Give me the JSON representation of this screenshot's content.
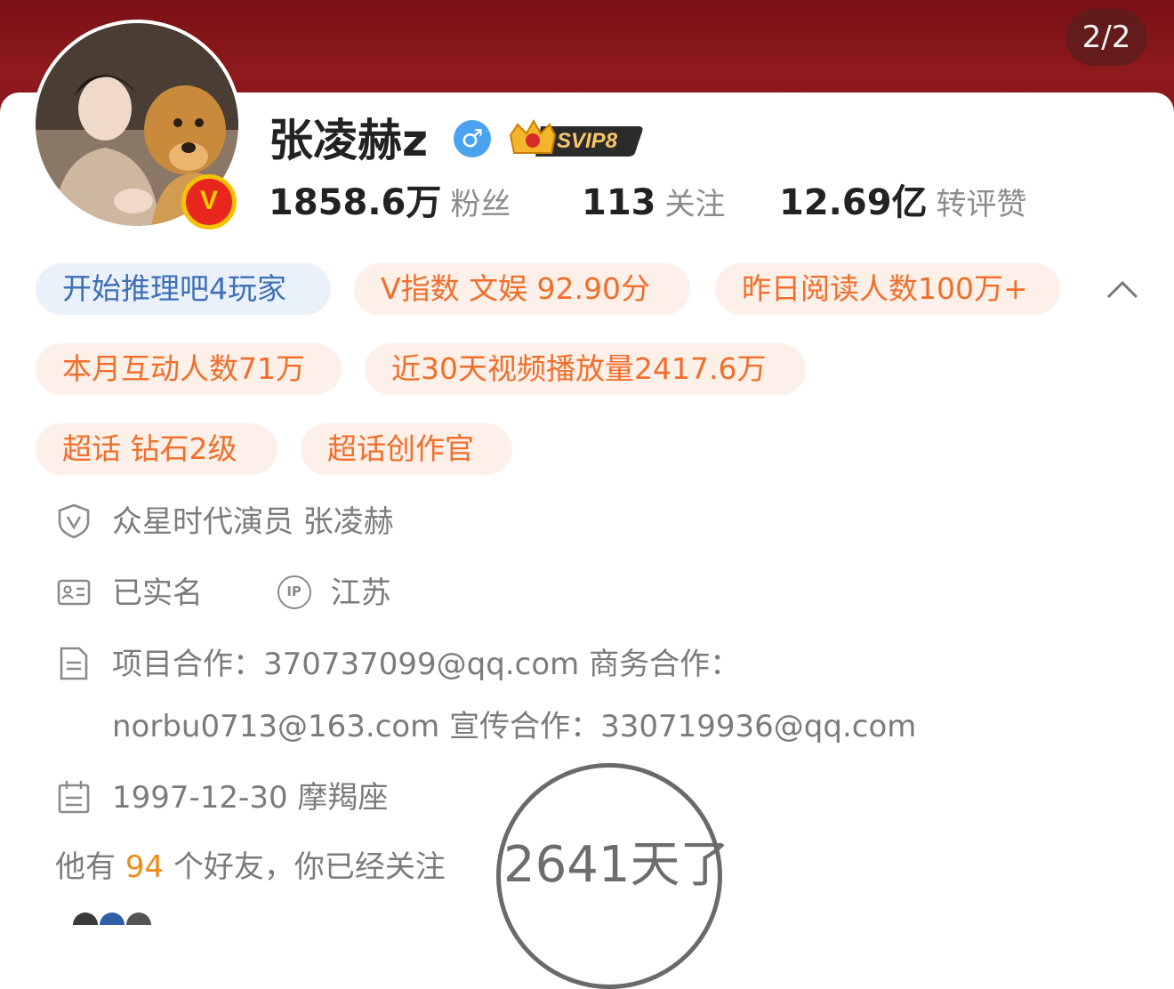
{
  "page_indicator": "2/2",
  "profile": {
    "name": "张凌赫z",
    "gender_symbol": "♂",
    "vip_label": "SVIP8",
    "verified_mark": "V"
  },
  "stats": [
    {
      "num": "1858.6万",
      "label": "粉丝"
    },
    {
      "num": "113",
      "label": "关注"
    },
    {
      "num": "12.69亿",
      "label": "转评赞"
    }
  ],
  "tags": [
    {
      "label": "开始推理吧4玩家",
      "style": "blue"
    },
    {
      "label": "V指数 文娱 92.90分",
      "style": "orange"
    },
    {
      "label": "昨日阅读人数100万+",
      "style": "orange"
    },
    {
      "label": "本月互动人数71万",
      "style": "orange"
    },
    {
      "label": "近30天视频播放量2417.6万",
      "style": "orange"
    },
    {
      "label": "超话 钻石2级",
      "style": "orange"
    },
    {
      "label": "超话创作官",
      "style": "orange"
    }
  ],
  "info": {
    "verification": "众星时代演员 张凌赫",
    "realname": "已实名",
    "ip_badge": "IP",
    "ip_location": "江苏",
    "contact_line1": "项目合作：370737099@qq.com 商务合作：",
    "contact_line2": "norbu0713@163.com 宣传合作：330719936@qq.com",
    "birthday": "1997-12-30 摩羯座"
  },
  "friends": {
    "prefix": "他有",
    "count": "94",
    "middle": "个好友，你已经关注",
    "days": "2641天了"
  },
  "colors": {
    "banner": "#8e1a1e",
    "tag_orange_text": "#f06e2c",
    "tag_orange_bg": "#fdf0e8",
    "tag_blue_text": "#3f6fb5",
    "tag_blue_bg": "#eaf1fb",
    "friend_count": "#f08a17"
  }
}
